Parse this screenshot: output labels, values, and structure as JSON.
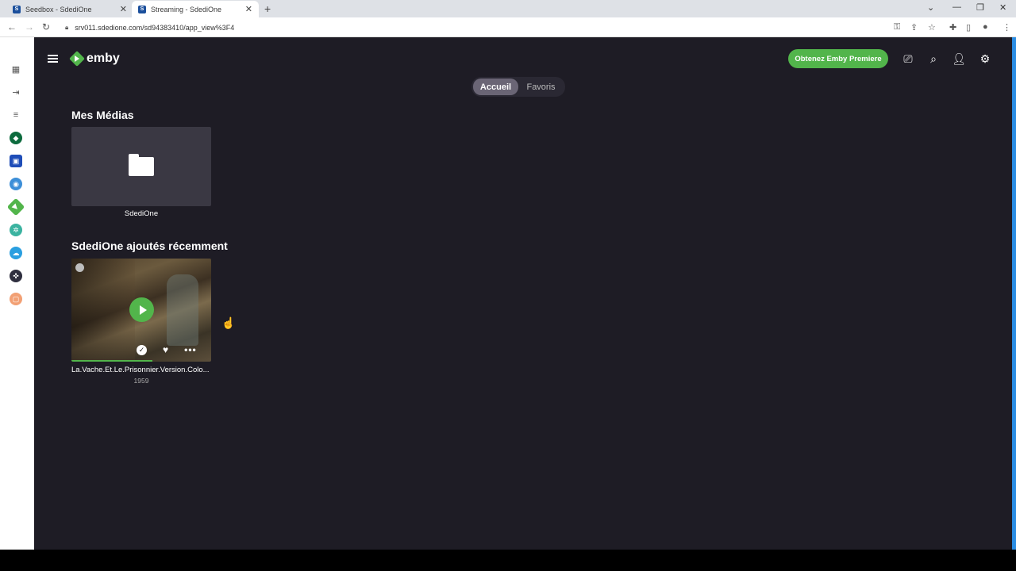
{
  "browser": {
    "tabs": [
      {
        "label": "Seedbox - SdediOne",
        "favicon": "S"
      },
      {
        "label": "Streaming - SdediOne",
        "favicon": "S"
      }
    ],
    "url": "srv011.sdedione.com/sd94383410/app_view%3F4"
  },
  "app": {
    "logo_text": "emby",
    "premiere_button": "Obtenez Emby Premiere",
    "home_tabs": [
      {
        "label": "Accueil",
        "active": true
      },
      {
        "label": "Favoris",
        "active": false
      }
    ],
    "section_media": "Mes Médias",
    "library": {
      "name": "SdediOne"
    },
    "section_recent": "SdediOne ajoutés récemment",
    "recent_item": {
      "title": "La.Vache.Et.Le.Prisonnier.Version.Colo...",
      "year": "1959",
      "progress": 0.58
    }
  },
  "colors": {
    "accent": "#52b54b",
    "background": "#1e1c25",
    "card": "#3a3843"
  }
}
